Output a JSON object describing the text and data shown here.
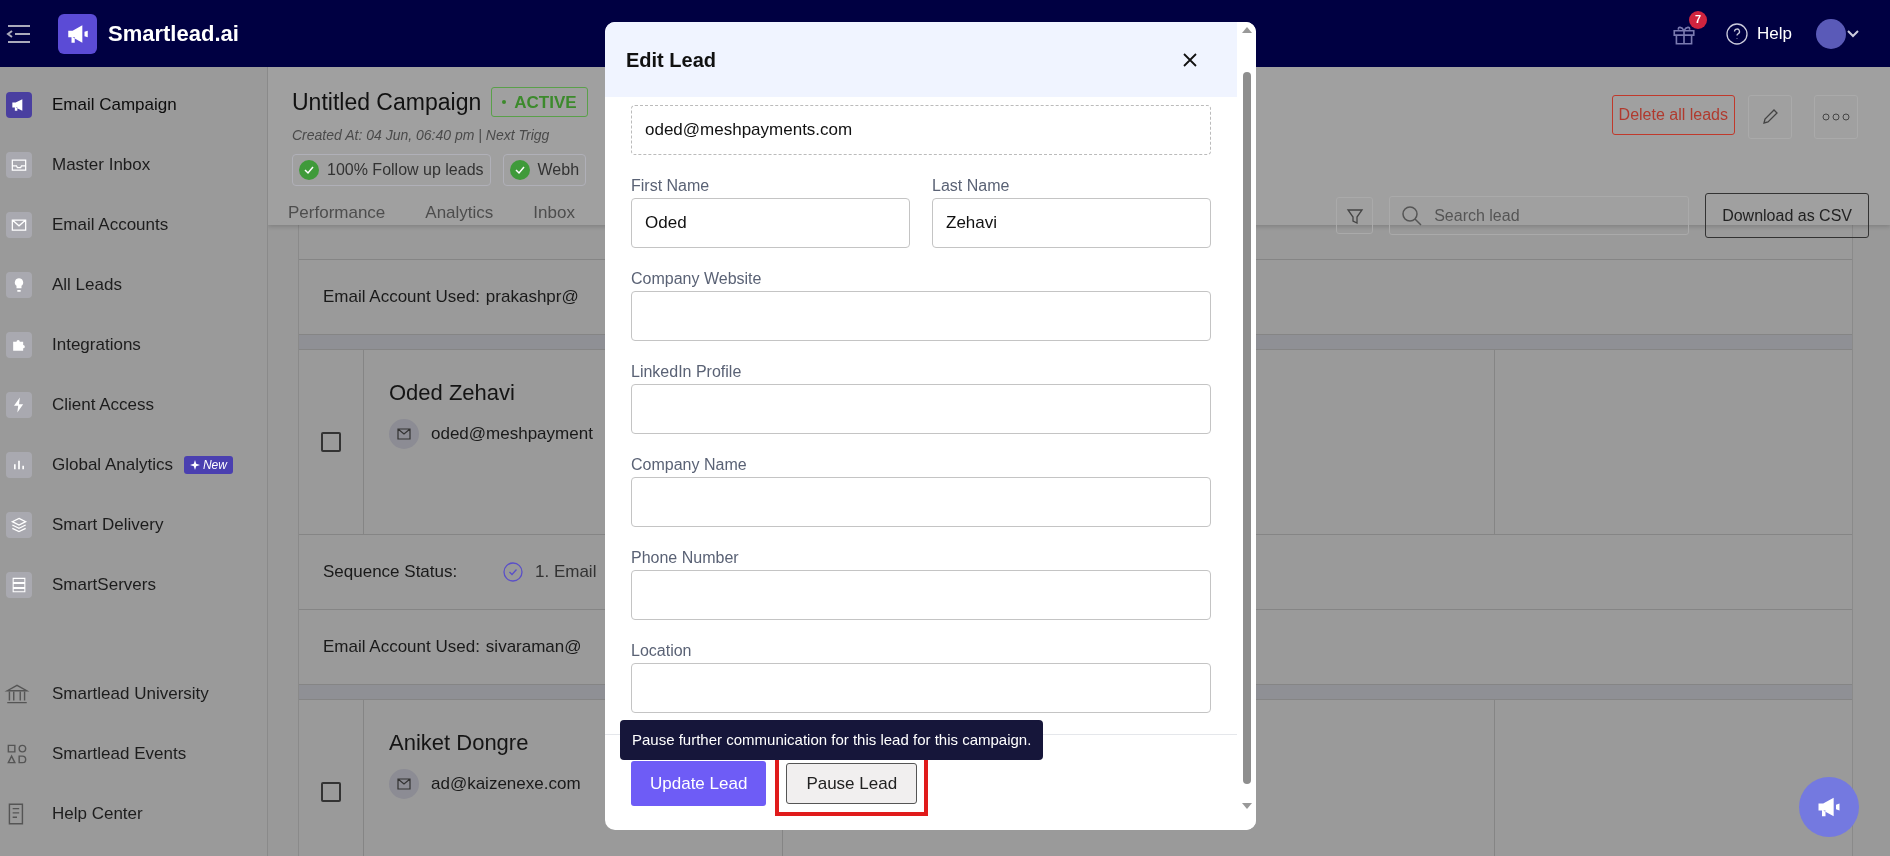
{
  "topbar": {
    "brand": "Smartlead.ai",
    "notification_count": "7",
    "help": "Help"
  },
  "sidebar": {
    "items": [
      {
        "label": "Email Campaign",
        "selected": true
      },
      {
        "label": "Master Inbox",
        "selected": false
      },
      {
        "label": "Email Accounts",
        "selected": false
      },
      {
        "label": "All Leads",
        "selected": false
      },
      {
        "label": "Integrations",
        "selected": false
      },
      {
        "label": "Client Access",
        "selected": false
      },
      {
        "label": "Global Analytics",
        "selected": false,
        "badge": "New"
      },
      {
        "label": "Smart Delivery",
        "selected": false
      },
      {
        "label": "SmartServers",
        "selected": false
      }
    ],
    "bottom_items": [
      {
        "label": "Smartlead University"
      },
      {
        "label": "Smartlead Events"
      },
      {
        "label": "Help Center"
      }
    ]
  },
  "campaign": {
    "title": "Untitled Campaign",
    "status": "ACTIVE",
    "meta": "Created At: 04 Jun, 06:40 pm | Next Trigg",
    "chips": [
      "100% Follow up leads",
      "Webh"
    ],
    "tabs": [
      "Performance",
      "Analytics",
      "Inbox"
    ],
    "delete_button": "Delete all leads",
    "search": {
      "placeholder": "Search lead"
    },
    "download_button": "Download as CSV"
  },
  "rows": [
    {
      "kind": "account",
      "label": "Email Account Used:",
      "value": "prakashpr@"
    },
    {
      "kind": "lead",
      "name": "Oded Zehavi",
      "email": "oded@meshpayment",
      "checked": false
    },
    {
      "kind": "sequence",
      "label": "Sequence Status:",
      "step": "1. Email"
    },
    {
      "kind": "account",
      "label": "Email Account Used:",
      "value": "sivaraman@"
    },
    {
      "kind": "lead",
      "name": "Aniket Dongre",
      "email": "ad@kaizenexe.com",
      "checked": false
    }
  ],
  "modal": {
    "title": "Edit Lead",
    "field_rows": [
      [
        {
          "value": "oded@meshpayments.com",
          "locked": true
        }
      ],
      [
        {
          "label": "First Name",
          "value": "Oded",
          "locked": false
        },
        {
          "label": "Last Name",
          "value": "Zehavi",
          "locked": false
        }
      ],
      [
        {
          "label": "Company Website",
          "locked": false
        }
      ],
      [
        {
          "label": "LinkedIn Profile",
          "locked": false
        }
      ],
      [
        {
          "label": "Company Name",
          "locked": false
        }
      ],
      [
        {
          "label": "Phone Number",
          "locked": false
        }
      ],
      [
        {
          "label": "Location",
          "locked": false
        }
      ]
    ],
    "tooltip": "Pause further communication for this lead for this campaign.",
    "buttons": [
      {
        "label": "Update Lead",
        "kind": "primary"
      },
      {
        "label": "Pause Lead",
        "kind": "secondary",
        "highlighted": true
      }
    ]
  }
}
